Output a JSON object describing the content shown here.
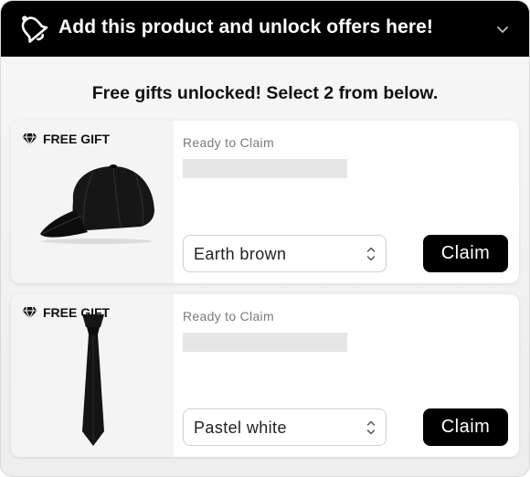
{
  "header": {
    "title": "Add this product and unlock offers here!"
  },
  "headline": "Free gifts unlocked! Select 2 from below.",
  "gifts": [
    {
      "badge": "FREE GIFT",
      "status": "Ready to Claim",
      "variant": "Earth brown",
      "claim_label": "Claim",
      "image": "black-baseball-cap"
    },
    {
      "badge": "FREE GIFT",
      "status": "Ready to Claim",
      "variant": "Pastel white",
      "claim_label": "Claim",
      "image": "black-necktie"
    }
  ],
  "icons": {
    "header": "bell-icon",
    "collapse": "chevron-down-icon",
    "badge": "diamond-icon",
    "select": "up-down-chevron-icon"
  },
  "colors": {
    "header_bg": "#000000",
    "button_bg": "#000000",
    "button_text": "#ffffff",
    "placeholder": "#e6e6e6"
  }
}
